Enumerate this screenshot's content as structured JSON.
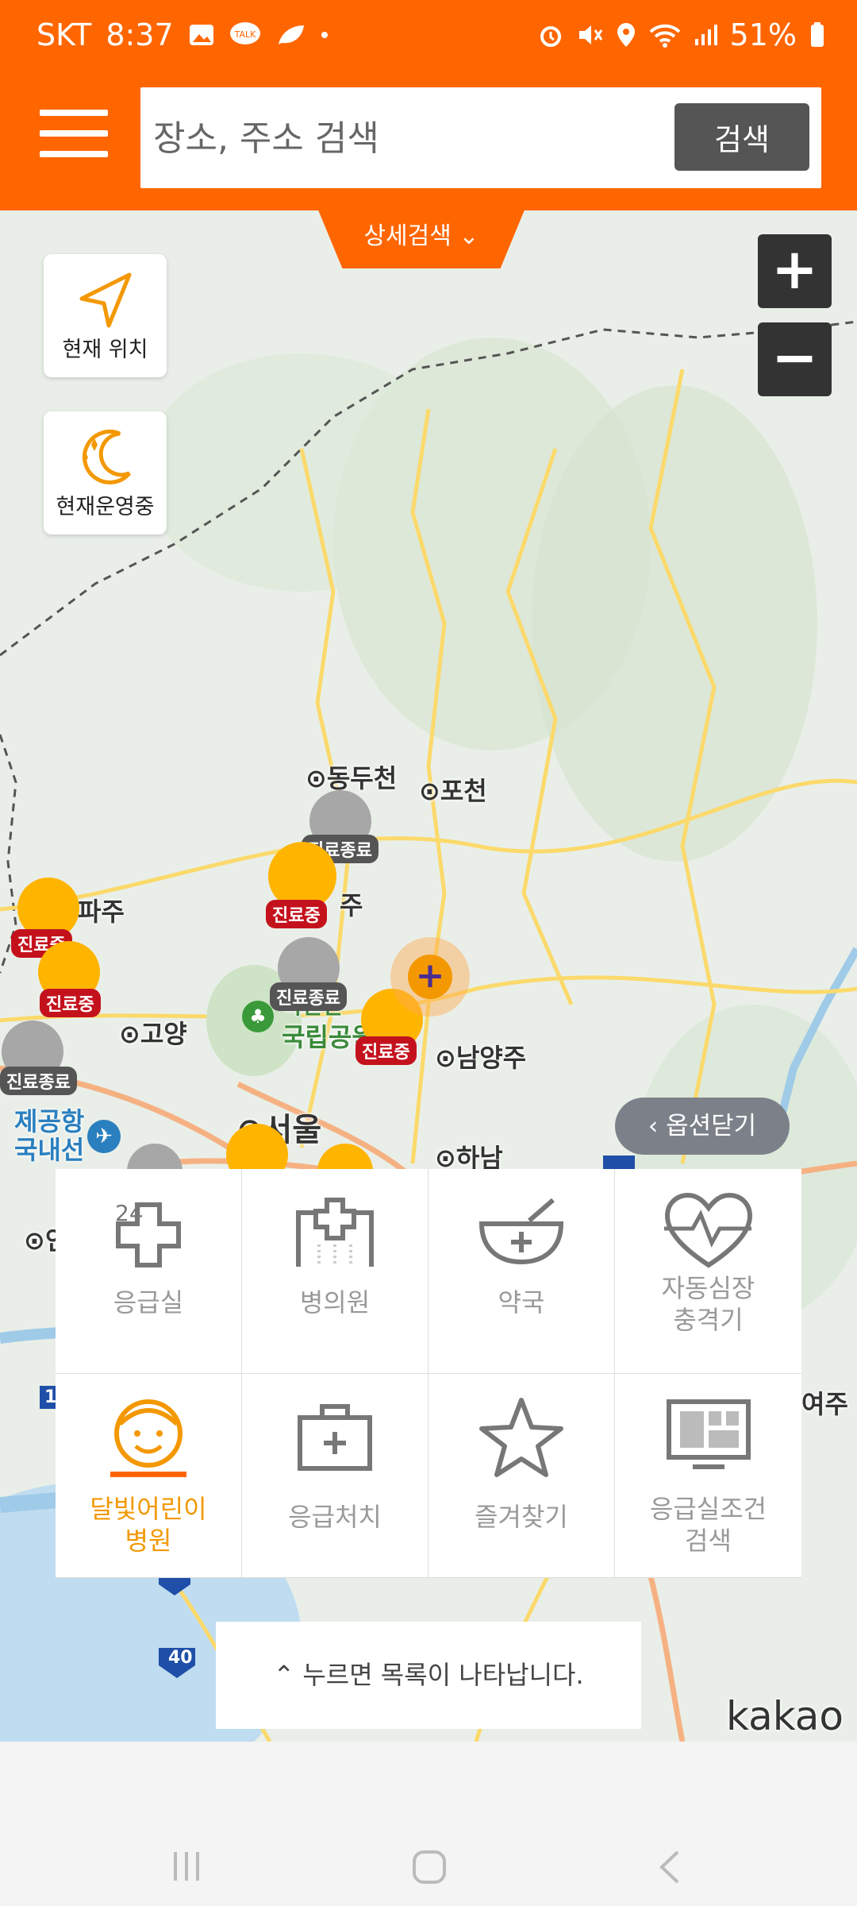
{
  "status": {
    "carrier": "SKT",
    "time": "8:37",
    "battery": "51%"
  },
  "header": {
    "search_placeholder": "장소, 주소 검색",
    "search_button": "검색"
  },
  "map": {
    "detail_search": "상세검색 ⌄",
    "zoom_in": "+",
    "zoom_out": "−",
    "current_location": "현재 위치",
    "currently_open": "현재운영중",
    "options_close": "옵션닫기",
    "places": {
      "dongducheon": "동두천",
      "pocheon": "포천",
      "paju": "파주",
      "yangju": "주",
      "goyang": "고양",
      "namyangju": "남양주",
      "seoul": "서울",
      "hanam": "하남",
      "gimpo_airport": "제공항",
      "domestic": "국내선",
      "national_park": "국립공원",
      "national_park_top": "북한산",
      "incheon": "인",
      "yeoju": "여주"
    },
    "markers": {
      "closed": "진료종료",
      "open": "진료중"
    },
    "logo": "kakao",
    "highway": "40",
    "highway2": "15"
  },
  "grid": {
    "items": [
      {
        "label": "응급실",
        "icon": "emergency-room-icon",
        "badge": "24"
      },
      {
        "label": "병의원",
        "icon": "hospital-icon"
      },
      {
        "label": "약국",
        "icon": "pharmacy-icon"
      },
      {
        "label": "자동심장\n충격기",
        "icon": "aed-icon"
      },
      {
        "label": "달빛어린이\n병원",
        "icon": "moonlight-child-icon"
      },
      {
        "label": "응급처치",
        "icon": "first-aid-icon"
      },
      {
        "label": "즐겨찾기",
        "icon": "star-icon"
      },
      {
        "label": "응급실조건\n검색",
        "icon": "monitor-icon"
      }
    ]
  },
  "list_hint": "누르면 목록이 나타납니다.",
  "colors": {
    "primary": "#FF6600",
    "active": "#F39800"
  }
}
